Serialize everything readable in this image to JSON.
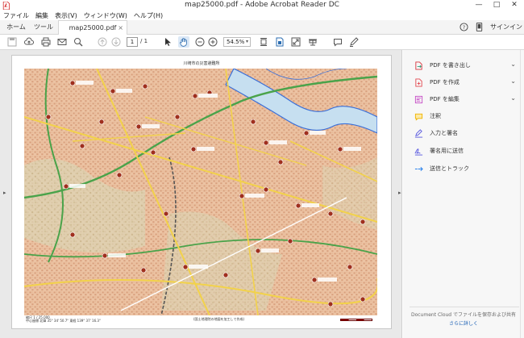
{
  "window": {
    "title": "map25000.pdf - Adobe Acrobat Reader DC",
    "minimize": "—",
    "maximize": "□",
    "close": "✕"
  },
  "menu": [
    "ファイル",
    "編集",
    "表示(V)",
    "ウィンドウ(W)",
    "ヘルプ(H)"
  ],
  "tabs": {
    "home": "ホーム",
    "tools": "ツール",
    "document": "map25000.pdf",
    "close": "×",
    "signin": "サインイン"
  },
  "toolbar": {
    "page_current": "1",
    "page_total": "/ 1",
    "zoom": "54.5%"
  },
  "map": {
    "title": "川崎市の災害避難所",
    "footer_left_1": "縮尺 1 / 25,000",
    "footer_left_2": "中心座標 北緯 35° 34' 50.7\"  東経 139° 37' 16.3\"",
    "footer_mid": "(国土地理院の地図を加工して作成)"
  },
  "panel": {
    "items": [
      {
        "label": "PDF を書き出し",
        "icon": "export-pdf-icon",
        "color": "#d7373f",
        "chevron": "⌄"
      },
      {
        "label": "PDF を作成",
        "icon": "create-pdf-icon",
        "color": "#e34850",
        "chevron": "⌄"
      },
      {
        "label": "PDF を編集",
        "icon": "edit-pdf-icon",
        "color": "#c74ec7",
        "chevron": "⌄"
      },
      {
        "label": "注釈",
        "icon": "comment-icon",
        "color": "#f0b400"
      },
      {
        "label": "入力と署名",
        "icon": "fill-sign-icon",
        "color": "#5c5ce0"
      },
      {
        "label": "署名用に送信",
        "icon": "send-signature-icon",
        "color": "#5c5ce0"
      },
      {
        "label": "送信とトラック",
        "icon": "send-track-icon",
        "color": "#2680eb"
      }
    ],
    "cloud_note": "Document Cloud でファイルを保存および共有",
    "learn_more": "さらに詳しく"
  }
}
